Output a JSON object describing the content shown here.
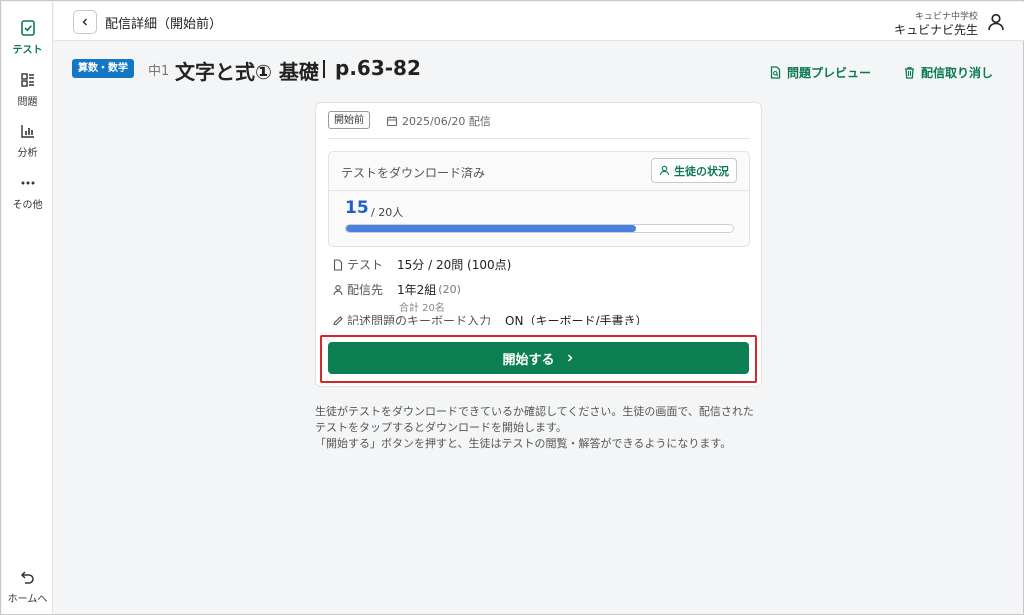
{
  "sidebar": {
    "items": [
      {
        "label": "テスト",
        "icon": "test-check-icon",
        "active": true
      },
      {
        "label": "問題",
        "icon": "problems-list-icon",
        "active": false
      },
      {
        "label": "分析",
        "icon": "analysis-chart-icon",
        "active": false
      },
      {
        "label": "その他",
        "icon": "more-dots-icon",
        "active": false
      }
    ],
    "home_label": "ホームへ"
  },
  "header": {
    "title": "配信詳細（開始前）",
    "school": "キュビナ中学校",
    "teacher": "キュビナビ先生"
  },
  "title_row": {
    "subject": "算数・数学",
    "grade": "中1",
    "title": "文字と式① 基礎",
    "pages": "p.63-82",
    "preview_label": "問題プレビュー",
    "cancel_label": "配信取り消し"
  },
  "card": {
    "status": "開始前",
    "date": "2025/06/20 配信",
    "download_title": "テストをダウンロード済み",
    "students_button": "生徒の状況",
    "downloaded_count": "15",
    "total_label": "/ 20人",
    "progress_fraction": 0.75,
    "test_label": "テスト",
    "test_value": "15分 / 20問 (100点)",
    "recipient_label": "配信先",
    "recipient_value": "1年2組",
    "recipient_count": "(20)",
    "recipient_total": "合計 20名",
    "keyboard_label": "記述問題のキーボード入力",
    "keyboard_value": "ON（キーボード/手書き）",
    "start_button": "開始する"
  },
  "notes": {
    "line1": "生徒がテストをダウンロードできているか確認してください。生徒の画面で、配信された",
    "line2": "テストをタップするとダウンロードを開始します。",
    "line3": "「開始する」ボタンを押すと、生徒はテストの閲覧・解答ができるようになります。"
  },
  "colors": {
    "accent_green": "#0b7f52",
    "subject_blue": "#1377c4",
    "progress_blue": "#4a7fdc",
    "highlight_red": "#d62828"
  }
}
